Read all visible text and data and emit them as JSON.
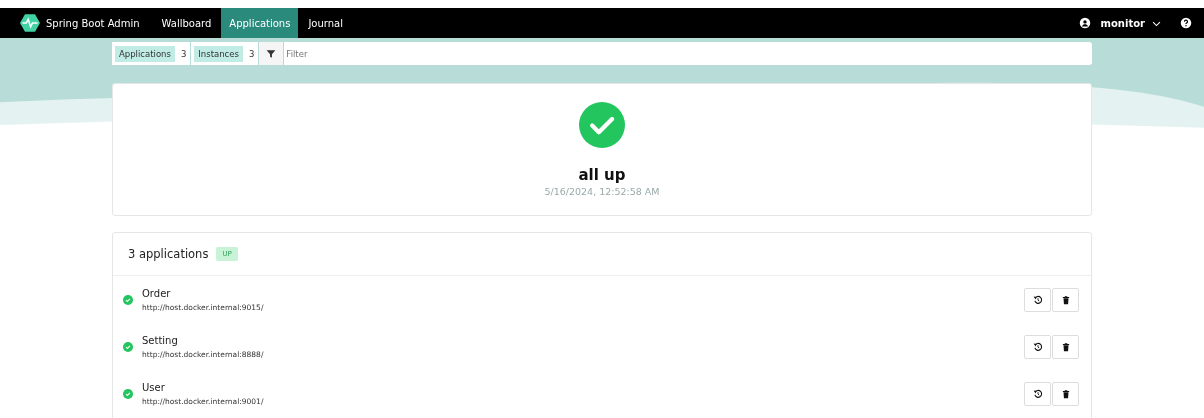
{
  "navbar": {
    "brand": "Spring Boot Admin",
    "items": [
      {
        "label": "Wallboard",
        "selected": false
      },
      {
        "label": "Applications",
        "selected": true
      },
      {
        "label": "Journal",
        "selected": false
      }
    ],
    "user": "monitor"
  },
  "filter_bar": {
    "counters": [
      {
        "label": "Applications",
        "count": "3"
      },
      {
        "label": "Instances",
        "count": "3"
      }
    ],
    "placeholder": "Filter"
  },
  "status_card": {
    "up": true,
    "title": "all up",
    "timestamp": "5/16/2024, 12:52:58 AM"
  },
  "applications": {
    "title": "3 applications",
    "badge": "UP",
    "items": [
      {
        "name": "Order",
        "url": "http://host.docker.internal:9015/",
        "up": true
      },
      {
        "name": "Setting",
        "url": "http://host.docker.internal:8888/",
        "up": true
      },
      {
        "name": "User",
        "url": "http://host.docker.internal:9001/",
        "up": true
      }
    ]
  }
}
